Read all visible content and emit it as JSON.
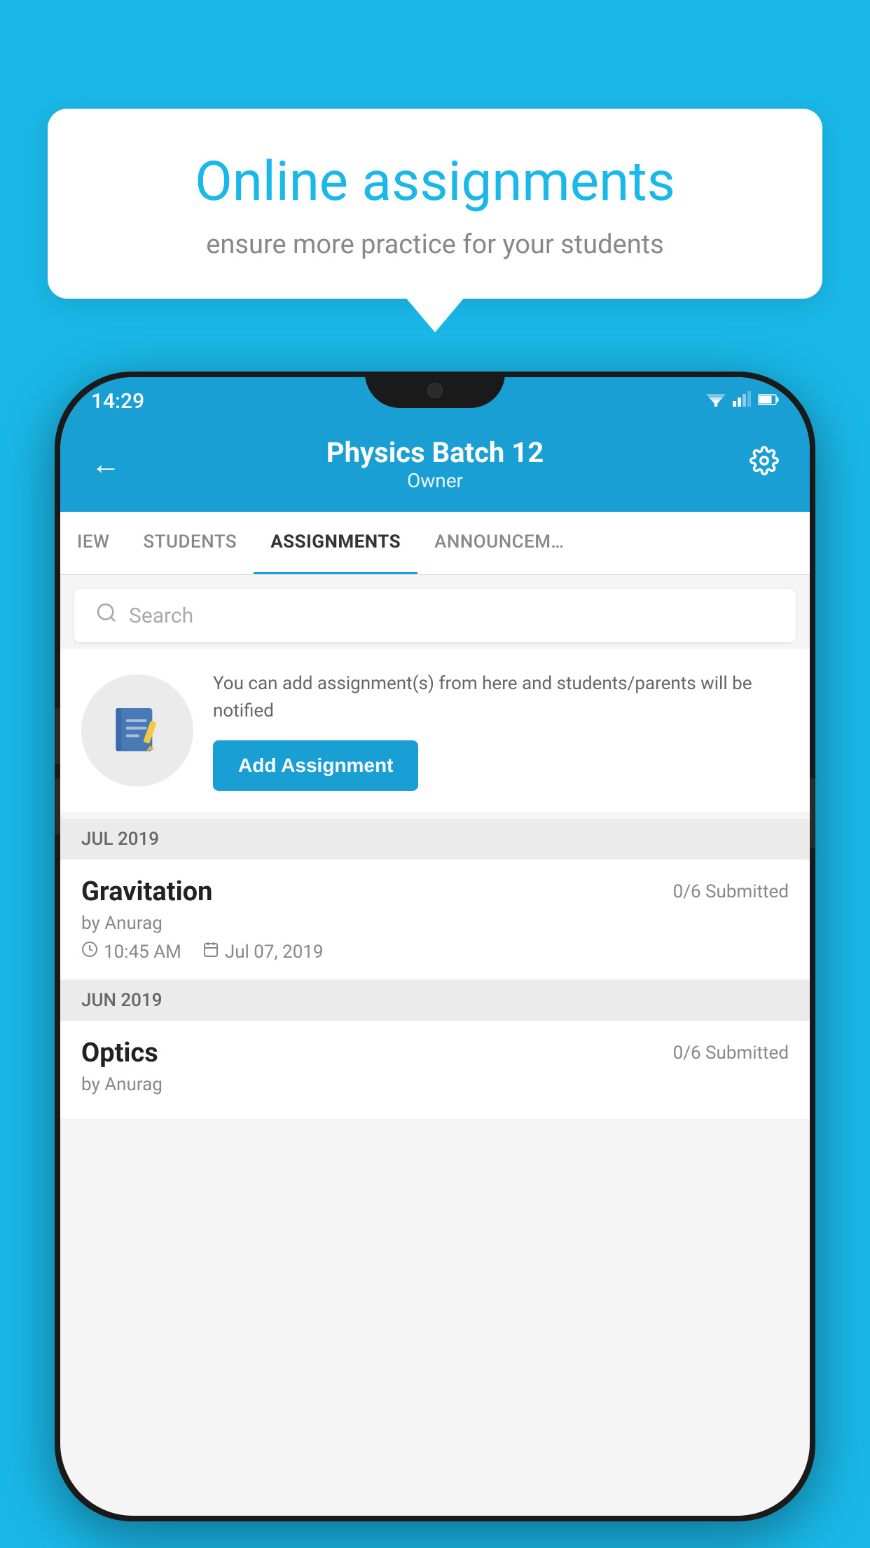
{
  "background_color": "#1ab8e8",
  "tooltip": {
    "title": "Online assignments",
    "subtitle": "ensure more practice for your students"
  },
  "phone": {
    "status_bar": {
      "time": "14:29"
    },
    "header": {
      "title": "Physics Batch 12",
      "subtitle": "Owner",
      "back_label": "←",
      "settings_label": "⚙"
    },
    "tabs": [
      {
        "label": "IEW",
        "active": false
      },
      {
        "label": "STUDENTS",
        "active": false
      },
      {
        "label": "ASSIGNMENTS",
        "active": true
      },
      {
        "label": "ANNOUNCEM…",
        "active": false
      }
    ],
    "search": {
      "placeholder": "Search"
    },
    "add_assignment_card": {
      "description": "You can add assignment(s) from here and students/parents will be notified",
      "button_label": "Add Assignment"
    },
    "sections": [
      {
        "month_label": "JUL 2019",
        "assignments": [
          {
            "name": "Gravitation",
            "submitted": "0/6 Submitted",
            "by": "by Anurag",
            "time": "10:45 AM",
            "date": "Jul 07, 2019"
          }
        ]
      },
      {
        "month_label": "JUN 2019",
        "assignments": [
          {
            "name": "Optics",
            "submitted": "0/6 Submitted",
            "by": "by Anurag",
            "time": "",
            "date": ""
          }
        ]
      }
    ]
  }
}
